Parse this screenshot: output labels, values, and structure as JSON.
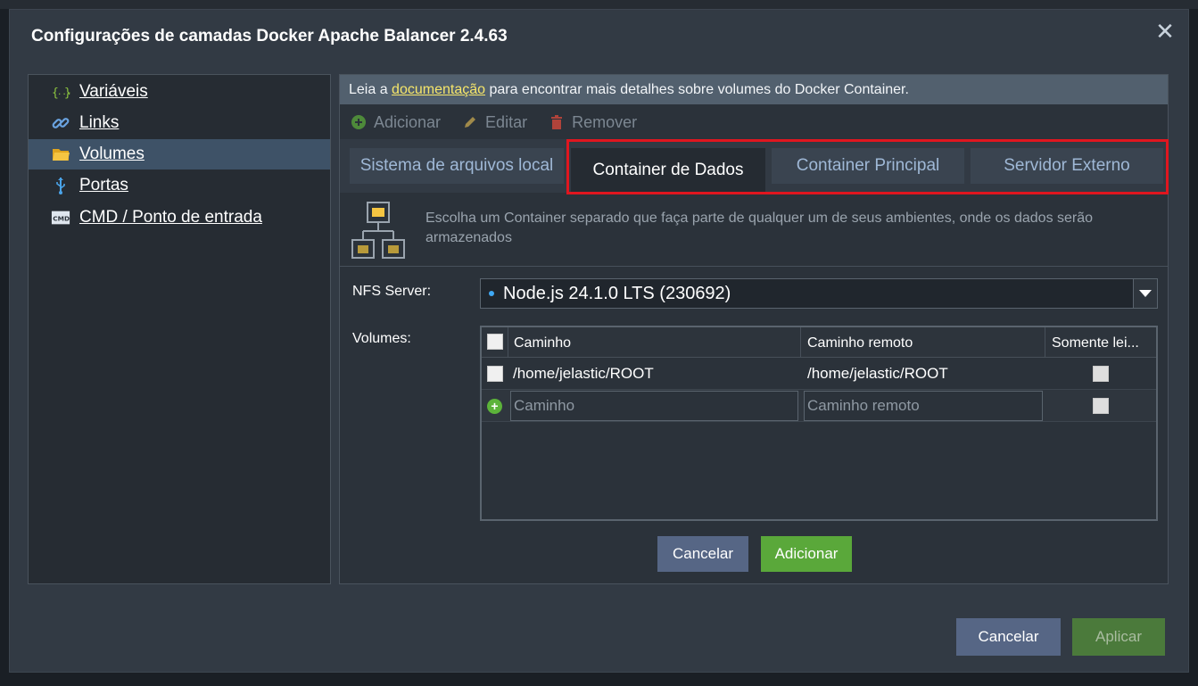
{
  "dialog": {
    "title": "Configurações de camadas Docker Apache Balancer 2.4.63",
    "close_icon": "close-icon"
  },
  "sidebar": {
    "items": [
      {
        "label": "Variáveis",
        "icon": "variables-icon",
        "active": false
      },
      {
        "label": "Links",
        "icon": "link-icon",
        "active": false
      },
      {
        "label": "Volumes",
        "icon": "folder-icon",
        "active": true
      },
      {
        "label": "Portas",
        "icon": "usb-port-icon",
        "active": false
      },
      {
        "label": "CMD / Ponto de entrada",
        "icon": "cmd-icon",
        "active": false
      }
    ]
  },
  "info": {
    "prefix": "Leia a ",
    "link": "documentação",
    "suffix": " para encontrar mais detalhes sobre volumes do Docker Container."
  },
  "toolbar": {
    "add": "Adicionar",
    "edit": "Editar",
    "remove": "Remover"
  },
  "tabs": [
    {
      "label": "Sistema de arquivos local",
      "active": false
    },
    {
      "label": "Container de Dados",
      "active": true
    },
    {
      "label": "Container Principal",
      "active": false
    },
    {
      "label": "Servidor Externo",
      "active": false
    }
  ],
  "description": "Escolha um Container separado que faça parte de qualquer um de seus ambientes, onde os dados serão armazenados",
  "form": {
    "nfs_label": "NFS Server:",
    "nfs_value": "Node.js 24.1.0 LTS (230692)",
    "volumes_label": "Volumes:"
  },
  "grid": {
    "columns": [
      "Caminho",
      "Caminho remoto",
      "Somente lei..."
    ],
    "rows": [
      {
        "path": "/home/jelastic/ROOT",
        "remote": "/home/jelastic/ROOT",
        "readonly": false
      }
    ],
    "new_row": {
      "path_placeholder": "Caminho",
      "remote_placeholder": "Caminho remoto"
    }
  },
  "inner_buttons": {
    "cancel": "Cancelar",
    "add": "Adicionar"
  },
  "footer": {
    "cancel": "Cancelar",
    "apply": "Aplicar"
  },
  "colors": {
    "accent_green": "#5aa83a",
    "highlight_red": "#e0161f",
    "link_yellow": "#f6e66a"
  }
}
